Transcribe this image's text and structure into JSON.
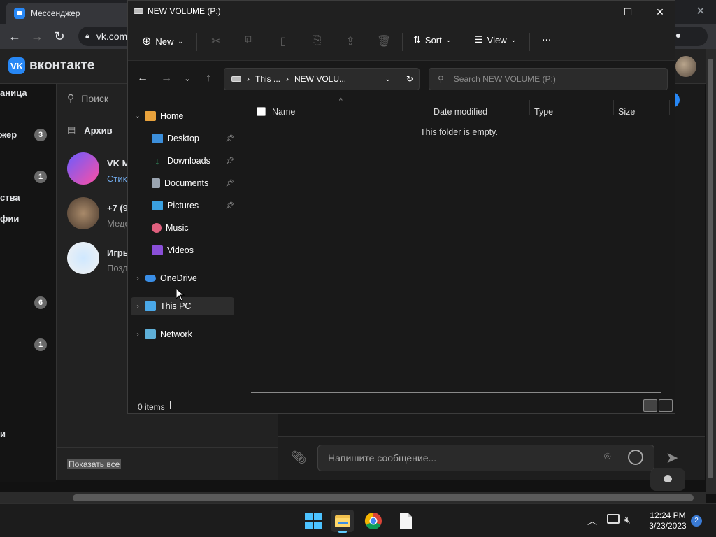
{
  "chrome": {
    "tab_title": "Мессенджер",
    "url": "vk.com"
  },
  "vk": {
    "brand": "вконтакте",
    "sidebar": [
      {
        "label": "аница"
      },
      {
        "label": "жер"
      },
      {
        "label": "ства"
      },
      {
        "label": "фии"
      },
      {
        "label": "и"
      }
    ],
    "badges": [
      "3",
      "1",
      "6",
      "1"
    ],
    "search_label": "Поиск",
    "archive_label": "Архив",
    "chats": [
      {
        "name": "VK M",
        "message": "Стик"
      },
      {
        "name": "+7 (9",
        "message": "Меде"
      },
      {
        "name": "Игры",
        "message": "Позд"
      }
    ],
    "show_all": "Показать все",
    "compose_placeholder": "Напишите сообщение..."
  },
  "explorer": {
    "title": "NEW VOLUME (P:)",
    "cmd": {
      "new": "New",
      "sort": "Sort",
      "view": "View",
      "more": "..."
    },
    "address": {
      "seg1": "This ...",
      "seg2": "NEW VOLU..."
    },
    "search_placeholder": "Search NEW VOLUME (P:)",
    "nav": {
      "home": "Home",
      "desktop": "Desktop",
      "downloads": "Downloads",
      "documents": "Documents",
      "pictures": "Pictures",
      "music": "Music",
      "videos": "Videos",
      "onedrive": "OneDrive",
      "thispc": "This PC",
      "network": "Network"
    },
    "columns": {
      "name": "Name",
      "date": "Date modified",
      "type": "Type",
      "size": "Size"
    },
    "empty_text": "This folder is empty.",
    "status": "0 items"
  },
  "taskbar": {
    "time": "12:24 PM",
    "date": "3/23/2023",
    "notifications": "2"
  },
  "colors": {
    "accent": "#60cdff",
    "vk_blue": "#2787f5"
  }
}
